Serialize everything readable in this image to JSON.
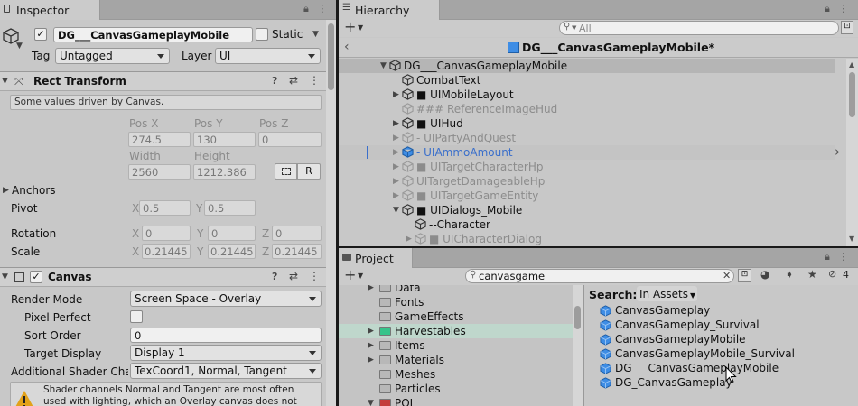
{
  "inspector": {
    "tab": "Inspector",
    "object_name": "DG___CanvasGameplayMobile",
    "static_label": "Static",
    "tag_label": "Tag",
    "tag_value": "Untagged",
    "layer_label": "Layer",
    "layer_value": "UI",
    "rect_transform": {
      "title": "Rect Transform",
      "notice": "Some values driven by Canvas.",
      "posx_label": "Pos X",
      "posy_label": "Pos Y",
      "posz_label": "Pos Z",
      "posx": "274.5",
      "posy": "130",
      "posz": "0",
      "width_label": "Width",
      "height_label": "Height",
      "width": "2560",
      "height": "1212.386",
      "r_button": "R",
      "anchors": "Anchors",
      "pivot_label": "Pivot",
      "pivot_x": "0.5",
      "pivot_y": "0.5",
      "rotation_label": "Rotation",
      "rot_x": "0",
      "rot_y": "0",
      "rot_z": "0",
      "scale_label": "Scale",
      "scale_x": "0.21445",
      "scale_y": "0.21445",
      "scale_z": "0.21445",
      "x": "X",
      "y": "Y",
      "z": "Z"
    },
    "canvas": {
      "title": "Canvas",
      "render_mode_label": "Render Mode",
      "render_mode": "Screen Space - Overlay",
      "pixel_perfect_label": "Pixel Perfect",
      "sort_order_label": "Sort Order",
      "sort_order": "0",
      "target_display_label": "Target Display",
      "target_display": "Display 1",
      "shader_label": "Additional Shader Char",
      "shader_value": "TexCoord1, Normal, Tangent",
      "warning": "Shader channels Normal and Tangent are most often used with lighting, which an Overlay canvas does not support. Its"
    }
  },
  "hierarchy": {
    "tab": "Hierarchy",
    "search_placeholder": "All",
    "scene_title": "DG___CanvasGameplayMobile*",
    "items": [
      {
        "label": "DG___CanvasGameplayMobile",
        "depth": 0,
        "expand": "open",
        "style": "root"
      },
      {
        "label": "CombatText",
        "depth": 1,
        "expand": "none",
        "style": "normal"
      },
      {
        "label": "■ UIMobileLayout",
        "depth": 1,
        "expand": "closed",
        "style": "normal"
      },
      {
        "label": "### ReferenceImageHud",
        "depth": 1,
        "expand": "none",
        "style": "gray"
      },
      {
        "label": "■ UIHud",
        "depth": 1,
        "expand": "closed",
        "style": "normal"
      },
      {
        "label": "- UIPartyAndQuest",
        "depth": 1,
        "expand": "closed",
        "style": "gray"
      },
      {
        "label": "- UIAmmoAmount",
        "depth": 1,
        "expand": "closed",
        "style": "blue"
      },
      {
        "label": "■ UITargetCharacterHp",
        "depth": 1,
        "expand": "closed",
        "style": "gray"
      },
      {
        "label": "UITargetDamageableHp",
        "depth": 1,
        "expand": "closed",
        "style": "gray"
      },
      {
        "label": "■ UITargetGameEntity",
        "depth": 1,
        "expand": "closed",
        "style": "gray"
      },
      {
        "label": "■ UIDialogs_Mobile",
        "depth": 1,
        "expand": "open",
        "style": "normal"
      },
      {
        "label": "--Character",
        "depth": 2,
        "expand": "none",
        "style": "normal"
      },
      {
        "label": "■ UICharacterDialog",
        "depth": 2,
        "expand": "closed",
        "style": "gray"
      }
    ]
  },
  "project": {
    "tab": "Project",
    "search_value": "canvasgame",
    "badge_count": "4",
    "folders": [
      {
        "label": "Data",
        "arrow": "closed",
        "color": "#b8b8b8"
      },
      {
        "label": "Fonts",
        "arrow": "none",
        "color": "#b8b8b8"
      },
      {
        "label": "GameEffects",
        "arrow": "none",
        "color": "#b8b8b8"
      },
      {
        "label": "Harvestables",
        "arrow": "closed",
        "color": "#36c48a"
      },
      {
        "label": "Items",
        "arrow": "closed",
        "color": "#b8b8b8"
      },
      {
        "label": "Materials",
        "arrow": "closed",
        "color": "#b8b8b8"
      },
      {
        "label": "Meshes",
        "arrow": "none",
        "color": "#b8b8b8"
      },
      {
        "label": "Particles",
        "arrow": "none",
        "color": "#b8b8b8"
      },
      {
        "label": "POI",
        "arrow": "open",
        "color": "#c43c3c"
      }
    ],
    "search_label": "Search:",
    "search_scope": "In Assets",
    "results": [
      "CanvasGameplay",
      "CanvasGameplay_Survival",
      "CanvasGameplayMobile",
      "CanvasGameplayMobile_Survival",
      "DG___CanvasGameplayMobile",
      "DG_CanvasGameplay"
    ]
  }
}
